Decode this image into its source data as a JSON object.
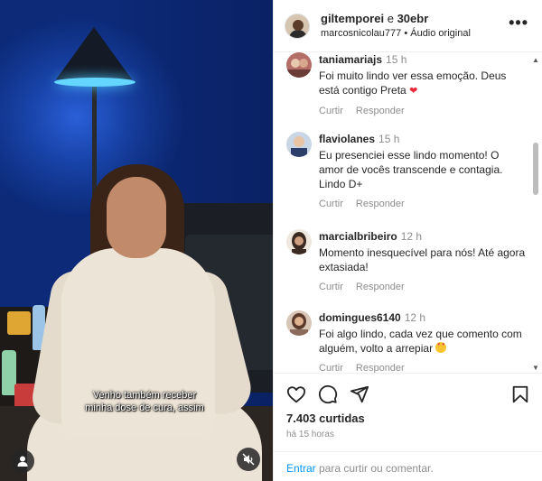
{
  "video": {
    "caption_line1": "Venho também receber",
    "caption_line2": "minha dose de cura, assim",
    "icons": {
      "user": "user-icon",
      "mute": "muted-speaker-icon"
    }
  },
  "header": {
    "user1": "giltemporei",
    "joiner": "e",
    "user2": "30ebr",
    "subtitle": "marcosnicolau777 • Áudio original",
    "more_icon": "more-horizontal-icon"
  },
  "comments": [
    {
      "user": "taniamariajs",
      "time": "15 h",
      "text": "Foi muito lindo ver essa emoção. Deus está contigo Preta",
      "emoji": "heart",
      "reply_a": "Curtir",
      "reply_b": "Responder"
    },
    {
      "user": "flaviolanes",
      "time": "15 h",
      "text": "Eu presenciei esse lindo momento! O amor de vocês transcende e contagia. Lindo D+",
      "emoji": "",
      "reply_a": "Curtir",
      "reply_b": "Responder"
    },
    {
      "user": "marcialbribeiro",
      "time": "12 h",
      "text": "Momento inesquecível para nós! Até agora extasiada!",
      "emoji": "",
      "reply_a": "Curtir",
      "reply_b": "Responder"
    },
    {
      "user": "domingues6140",
      "time": "12 h",
      "text": "Foi algo lindo, cada vez que comento com alguém, volto a arrepiar",
      "emoji": "heart-eyes",
      "reply_a": "Curtir",
      "reply_b": "Responder"
    }
  ],
  "actions": {
    "icons": [
      "heart-icon",
      "comment-icon",
      "share-icon",
      "bookmark-icon"
    ]
  },
  "likes": "7.403 curtidas",
  "posted": "há 15 horas",
  "compose": {
    "enter": "Entrar",
    "placeholder": "para curtir ou comentar."
  },
  "colors": {
    "link": "#0095f6",
    "muted": "#8e8e8e",
    "text": "#262626",
    "heart": "#ed2a3a"
  }
}
